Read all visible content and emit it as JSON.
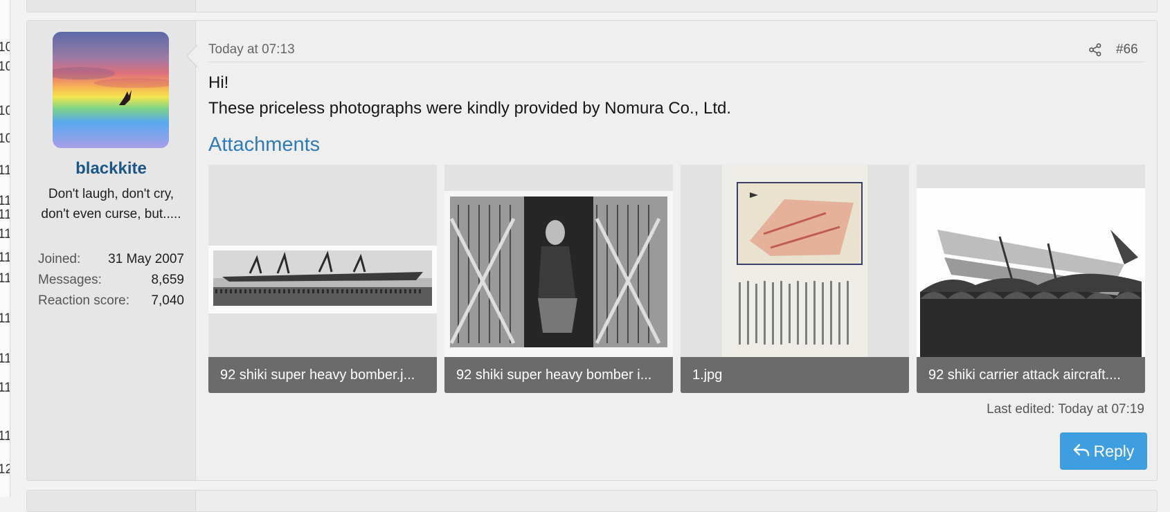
{
  "left_strip": {
    "line_numbers": [
      "10",
      "10",
      "10",
      "10",
      "11",
      "11",
      "11",
      "11",
      "11",
      "11",
      "11",
      "11",
      "11",
      "11",
      "12"
    ]
  },
  "post": {
    "user": {
      "avatar_icon": "bird-in-sunset-sky-avatar",
      "name": "blackkite",
      "title": "Don't laugh, don't cry, don't even curse, but.....",
      "stats": [
        {
          "label": "Joined:",
          "value": "31 May 2007"
        },
        {
          "label": "Messages:",
          "value": "8,659"
        },
        {
          "label": "Reaction score:",
          "value": "7,040"
        }
      ]
    },
    "date": "Today at 07:13",
    "share_icon": "share-icon",
    "number": "#66",
    "body_lines": [
      "Hi!",
      "These priceless photographs were kindly provided by Nomura Co., Ltd."
    ],
    "attachments_title": "Attachments",
    "attachments": [
      {
        "label": "92 shiki super heavy bomber.j..."
      },
      {
        "label": "92 shiki super heavy bomber i..."
      },
      {
        "label": "1.jpg"
      },
      {
        "label": "92 shiki carrier attack aircraft...."
      }
    ],
    "last_edited": "Last edited: Today at 07:19",
    "reply_label": "Reply",
    "reply_icon": "reply-arrow-icon"
  },
  "colors": {
    "username": "#1b5687",
    "attachments_title": "#2f7bb5",
    "reply_button": "#3f9ee0"
  }
}
